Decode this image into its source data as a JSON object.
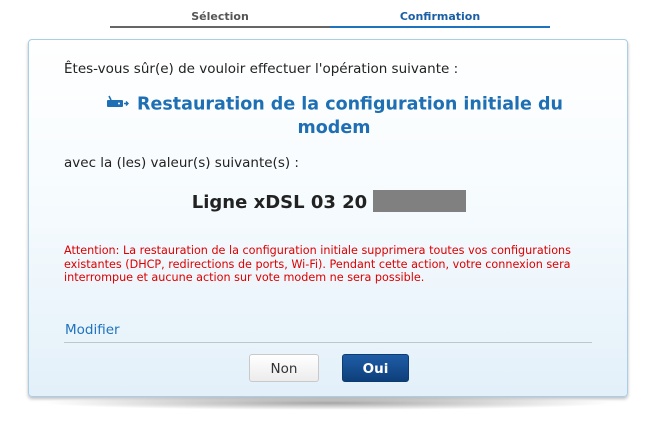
{
  "stepper": {
    "steps": [
      {
        "label": "Sélection"
      },
      {
        "label": "Confirmation"
      }
    ]
  },
  "dialog": {
    "question": "Êtes-vous sûr(e) de vouloir effectuer l'opération suivante :",
    "operation_title": "Restauration de la configuration initiale du modem",
    "operation_icon": "modem-reset-icon",
    "values_intro": "avec la (les) valeur(s) suivante(s) :",
    "value": "Ligne xDSL 03 20",
    "warning": "Attention: La restauration de la configuration initiale supprimera toutes vos configurations existantes (DHCP, redirections de ports, Wi-Fi). Pendant cette action, votre connexion sera interrompue et aucune action sur vote modem ne sera possible.",
    "modify_link": "Modifier",
    "buttons": {
      "no": "Non",
      "yes": "Oui"
    }
  },
  "colors": {
    "accent": "#1e73be",
    "title": "#1e6fb3",
    "warning": "#dd0000",
    "primary_button": "#0d3f7a"
  }
}
